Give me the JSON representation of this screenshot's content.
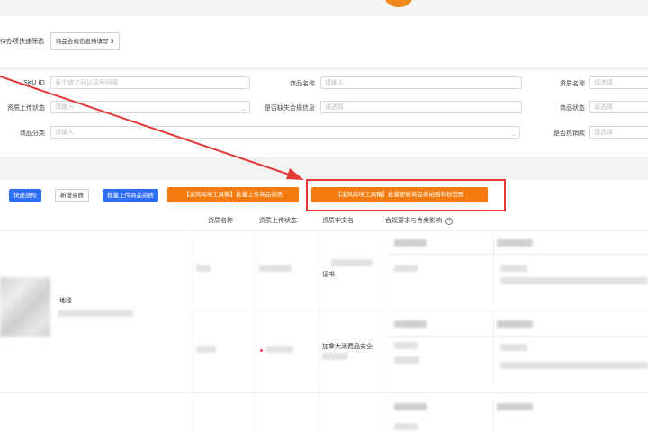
{
  "todo": {
    "label": "待办项快速筛选",
    "chip": "商品合规信息待填写 3"
  },
  "filters": {
    "sku_id": {
      "label": "SKU ID",
      "placeholder": "多个值之间以逗号间隔"
    },
    "product_name": {
      "label": "商品名称",
      "placeholder": "请输入"
    },
    "qual_name": {
      "label": "资质名称",
      "placeholder": "请选择"
    },
    "qual_upload_status": {
      "label": "资质上传状态",
      "placeholder": "请输入"
    },
    "missing_compliance": {
      "label": "是否缺失合规信息",
      "placeholder": "请选择"
    },
    "product_status": {
      "label": "商品状态",
      "placeholder": "请选择"
    },
    "category": {
      "label": "商品分类",
      "placeholder": "请输入"
    },
    "hot_selling": {
      "label": "是否热销款",
      "placeholder": "请选择"
    }
  },
  "toolbar": {
    "quick_check": "快速送检",
    "new_qual": "新增资质",
    "batch_upload_qual": "批量上传商品资质",
    "lingfeng_batch_upload": "【凌风跨境工具箱】批量上传商品资质",
    "lingfeng_batch_update": "【凌风跨境工具箱】批量更新商品实拍图和标签图"
  },
  "table": {
    "headers": [
      "资质名称",
      "资质上传状态",
      "资质中文名",
      "合规要求与售卖影响"
    ],
    "help_icon": "question-circle-icon",
    "rows": [
      {
        "name": "地毯",
        "qual_cn_suffix": "证书"
      },
      {
        "qual_cn": "加拿大消费品安全"
      }
    ]
  },
  "colors": {
    "primary": "#2d6df6",
    "accent_orange": "#f57b0f",
    "annotation_red": "#e53935"
  }
}
